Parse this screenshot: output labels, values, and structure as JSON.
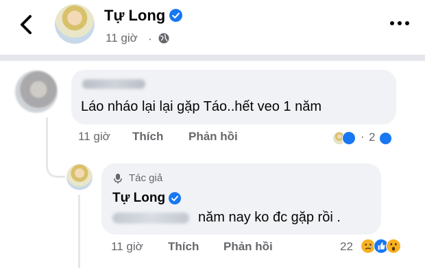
{
  "header": {
    "name": "Tự Long",
    "time": "11 giờ",
    "separator": "·"
  },
  "comments": [
    {
      "text": "Láo nháo lại lại gặp Táo..hết veo 1 năm",
      "actions": {
        "time": "11 giờ",
        "like": "Thích",
        "reply": "Phản hồi"
      },
      "reactions": {
        "separator": "·",
        "count": "2",
        "icons": [
          "author-avatar",
          "like-icon"
        ]
      }
    },
    {
      "author_label": "Tác giả",
      "name": "Tự Long",
      "text": "năm nay ko đc gặp rồi .",
      "actions": {
        "time": "11 giờ",
        "like": "Thích",
        "reply": "Phản hồi"
      },
      "reactions": {
        "count": "22",
        "icons": [
          "sad-icon",
          "like-icon",
          "wow-icon"
        ]
      }
    }
  ],
  "colors": {
    "brand": "#1877f2",
    "muted_text": "#65676b",
    "bubble": "#f0f2f5",
    "divider": "#e4e6eb"
  }
}
